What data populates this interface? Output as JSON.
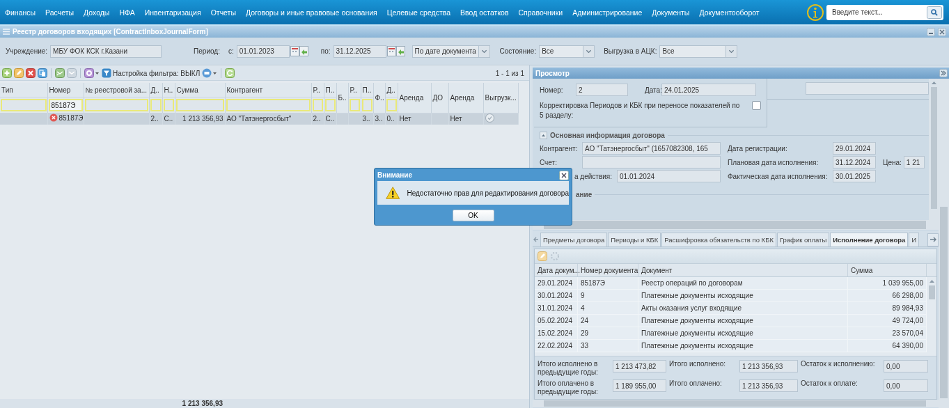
{
  "menu": {
    "items": [
      "Финансы",
      "Расчеты",
      "Доходы",
      "НФА",
      "Инвентаризация",
      "Отчеты",
      "Договоры и иные правовые основания",
      "Целевые средства",
      "Ввод остатков",
      "Справочники",
      "Администрирование",
      "Документы",
      "Документооборот"
    ],
    "search": {
      "placeholder": "Введите текст..."
    }
  },
  "window": {
    "title": "Реестр договоров входящих [ContractInboxJournalForm]"
  },
  "filters": {
    "institution": {
      "label": "Учреждение:",
      "value": "МБУ ФОК КСК г.Казани"
    },
    "period": {
      "label": "Период:",
      "from_label": "с:",
      "from": "01.01.2023",
      "to_label": "по:",
      "to": "31.12.2025",
      "mode": "По дате документа"
    },
    "state": {
      "label": "Состояние:",
      "value": "Все"
    },
    "export": {
      "label": "Выгрузка в АЦК:",
      "value": "Все"
    }
  },
  "journal": {
    "toolbar": {
      "filter_setting": "Настройка фильтра: ВЫКЛ",
      "pager": "1 - 1 из 1"
    },
    "columns": [
      {
        "label": "Тип",
        "filter": true
      },
      {
        "label": "Номер",
        "filter": true,
        "filter_value": "85187Э"
      },
      {
        "label": "№ реестровой за...",
        "filter": true
      },
      {
        "label": "Д..",
        "filter": true
      },
      {
        "label": "Н..",
        "filter": true
      },
      {
        "label": "Сумма",
        "filter": true
      },
      {
        "label": "Контрагент",
        "filter": true
      },
      {
        "label": "Р..",
        "filter": true
      },
      {
        "label": "П..",
        "filter": true
      },
      {
        "label": "Б..",
        "filter": false
      },
      {
        "label": "Р..",
        "filter": true
      },
      {
        "label": "П..",
        "filter": true
      },
      {
        "label": "Ф..",
        "filter": false
      },
      {
        "label": "Д..",
        "filter": true
      },
      {
        "label": "Аренда",
        "filter": false
      },
      {
        "label": "ДО",
        "filter": false
      },
      {
        "label": "Аренда",
        "filter": false
      },
      {
        "label": "Выгрузк...",
        "filter": false
      }
    ],
    "rows": [
      {
        "selected": true,
        "error": true,
        "export_mark": true,
        "cells": [
          null,
          "85187Э",
          null,
          "2..",
          "С..",
          "1 213 356,93",
          "АО \"Татэнергосбыт\"",
          "2..",
          "С..",
          null,
          null,
          "3..",
          "3..",
          "0..",
          "Нет",
          null,
          "Нет",
          null
        ]
      }
    ],
    "total": "1 213 356,93"
  },
  "preview": {
    "title": "Просмотр",
    "number": {
      "label": "Номер:",
      "value": "2"
    },
    "date": {
      "label": "Дата:",
      "value": "24.01.2025"
    },
    "correction": {
      "label": "Корректировка Периодов и КБК при переносе показателей по 5 разделу:",
      "checked": false
    },
    "main_section": {
      "title": "Основная информация договора",
      "expanded": true,
      "rows": [
        {
          "left": {
            "label": "Контрагент:",
            "value": "АО \"Татэнергосбыт\" (1657082308, 165"
          },
          "right": {
            "label": "Дата регистрации:",
            "value": "29.01.2024"
          }
        },
        {
          "left": {
            "label": "Счет:"
          },
          "right": {
            "label": "Плановая дата исполнения:",
            "value": "31.12.2024"
          },
          "extra": {
            "label": "Цена:",
            "value": "1 21"
          }
        },
        {
          "left": {
            "label": "а действия:",
            "value": "01.01.2024"
          },
          "right": {
            "label": "Фактическая дата исполнения:",
            "value": "30.01.2025"
          }
        }
      ]
    },
    "note_section": {
      "title": "ание"
    },
    "tabs": [
      {
        "label": "Предметы договора",
        "selected": false
      },
      {
        "label": "Периоды и КБК",
        "selected": false
      },
      {
        "label": "Расшифровка обязательств по КБК",
        "selected": false
      },
      {
        "label": "График оплаты",
        "selected": false
      },
      {
        "label": "Исполнение договора",
        "selected": true
      },
      {
        "label": "И",
        "selected": false
      }
    ],
    "execution": {
      "columns": [
        "Дата докум...",
        "Номер документа",
        "Документ",
        "Сумма"
      ],
      "rows": [
        [
          "29.01.2024",
          "85187Э",
          "Реестр операций по договорам",
          "1 039 955,00"
        ],
        [
          "30.01.2024",
          "9",
          "Платежные документы исходящие",
          "66 298,00"
        ],
        [
          "31.01.2024",
          "4",
          "Акты оказания услуг входящие",
          "89 984,93"
        ],
        [
          "05.02.2024",
          "24",
          "Платежные документы исходящие",
          "49 724,00"
        ],
        [
          "15.02.2024",
          "29",
          "Платежные документы исходящие",
          "23 570,04"
        ],
        [
          "22.02.2024",
          "33",
          "Платежные документы исходящие",
          "64 390,00"
        ]
      ]
    },
    "totals": [
      {
        "label": "Итого исполнено в предыдущие годы:",
        "value": "1 213 473,82"
      },
      {
        "label": "Итого исполнено:",
        "value": "1 213 356,93"
      },
      {
        "label": "Остаток к исполнению:",
        "value": "0,00"
      },
      {
        "label": "Итого оплачено в предыдущие годы:",
        "value": "1 189 955,00"
      },
      {
        "label": "Итого оплачено:",
        "value": "1 213 356,93"
      },
      {
        "label": "Остаток к оплате:",
        "value": "0,00"
      }
    ]
  },
  "dialog": {
    "title": "Внимание",
    "message": "Недостаточно прав для редактирования договора",
    "button": "OK"
  }
}
